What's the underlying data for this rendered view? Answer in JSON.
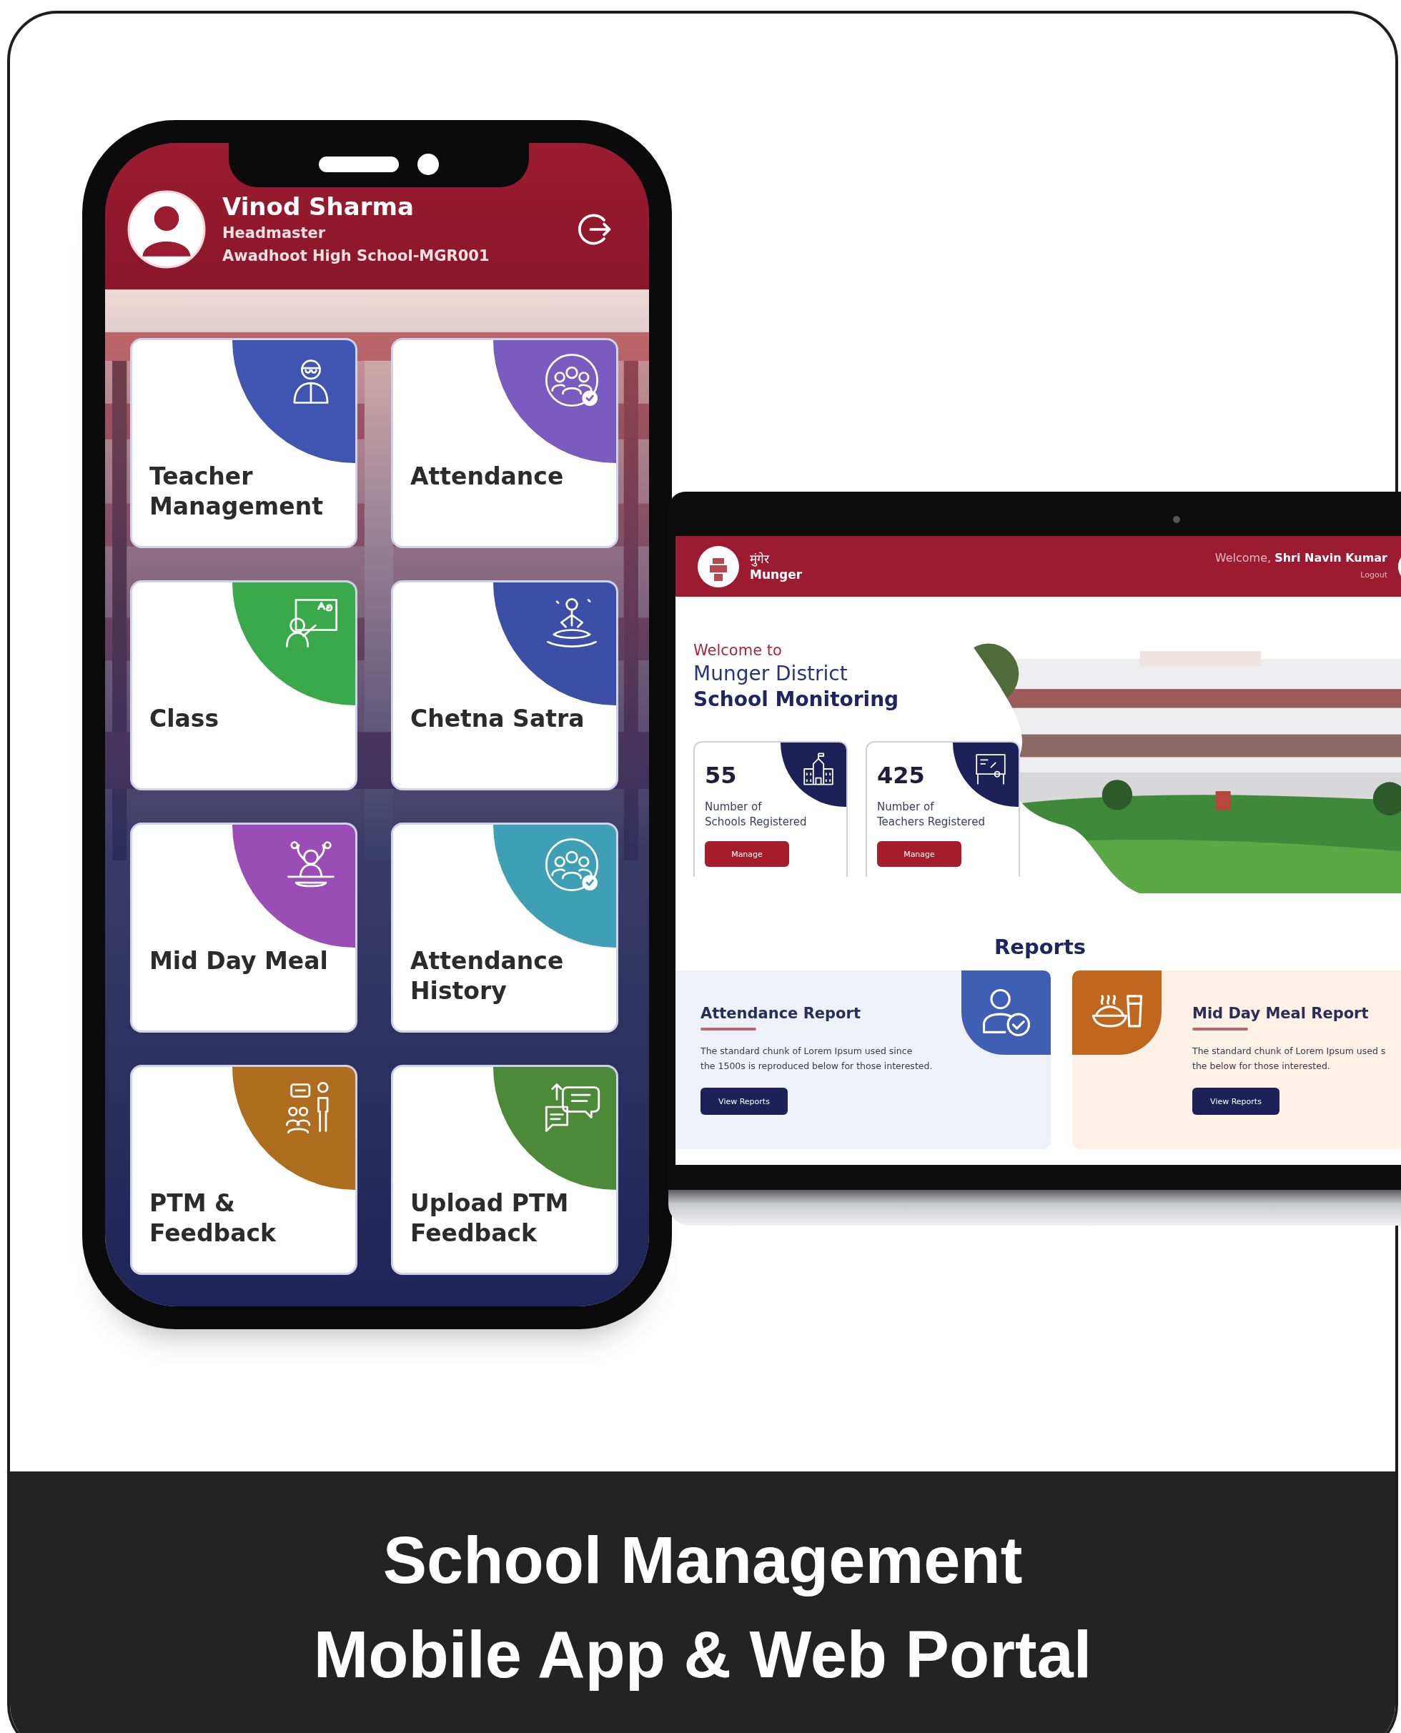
{
  "phone": {
    "user": {
      "name": "Vinod Sharma",
      "role": "Headmaster",
      "school": "Awadhoot High School-MGR001"
    },
    "tiles": [
      {
        "kind": "teacher",
        "lines": [
          "Teacher",
          "Management"
        ],
        "color": "#3f55b0"
      },
      {
        "kind": "attendance",
        "lines": [
          "Attendance"
        ],
        "color": "#7a5cc0"
      },
      {
        "kind": "class",
        "lines": [
          "Class"
        ],
        "color": "#3aa94c"
      },
      {
        "kind": "meditation",
        "lines": [
          "Chetna Satra"
        ],
        "color": "#3c4ea6"
      },
      {
        "kind": "meal",
        "lines": [
          "Mid Day Meal"
        ],
        "color": "#9a4db5"
      },
      {
        "kind": "history",
        "lines": [
          "Attendance",
          "History"
        ],
        "color": "#3f9fb4"
      },
      {
        "kind": "meeting",
        "lines": [
          "PTM &",
          "Feedback"
        ],
        "color": "#ae6c1e"
      },
      {
        "kind": "feedback",
        "lines": [
          "Upload PTM",
          "Feedback"
        ],
        "color": "#4c8a39"
      }
    ]
  },
  "portal": {
    "brand": {
      "hindi": "मुंगेर",
      "name": "Munger"
    },
    "greeting": "Welcome,",
    "user": "Shri Navin Kumar",
    "logout": "Logout",
    "intro": {
      "kicker": "Welcome to",
      "line1": "Munger District",
      "line2": "School Monitoring"
    },
    "stats": [
      {
        "kind": "school",
        "value": "55",
        "lines": [
          "Number of",
          "Schools Registered"
        ],
        "button": "Manage"
      },
      {
        "kind": "teacher",
        "value": "425",
        "lines": [
          "Number of",
          "Teachers Registered"
        ],
        "button": "Manage"
      }
    ],
    "reports_title": "Reports",
    "reports": [
      {
        "kind": "attendance",
        "title": "Attendance Report",
        "lines": [
          "The standard chunk of Lorem Ipsum used since",
          "the 1500s is reproduced below for those interested."
        ],
        "button": "View Reports",
        "color": "#3f5fb2"
      },
      {
        "kind": "meal",
        "title": "Mid Day Meal Report",
        "lines": [
          "The standard chunk of Lorem Ipsum used s",
          "the below for those interested."
        ],
        "button": "View Reports",
        "color": "#c0671f"
      }
    ]
  },
  "caption": [
    "School Management",
    "Mobile App & Web Portal"
  ]
}
